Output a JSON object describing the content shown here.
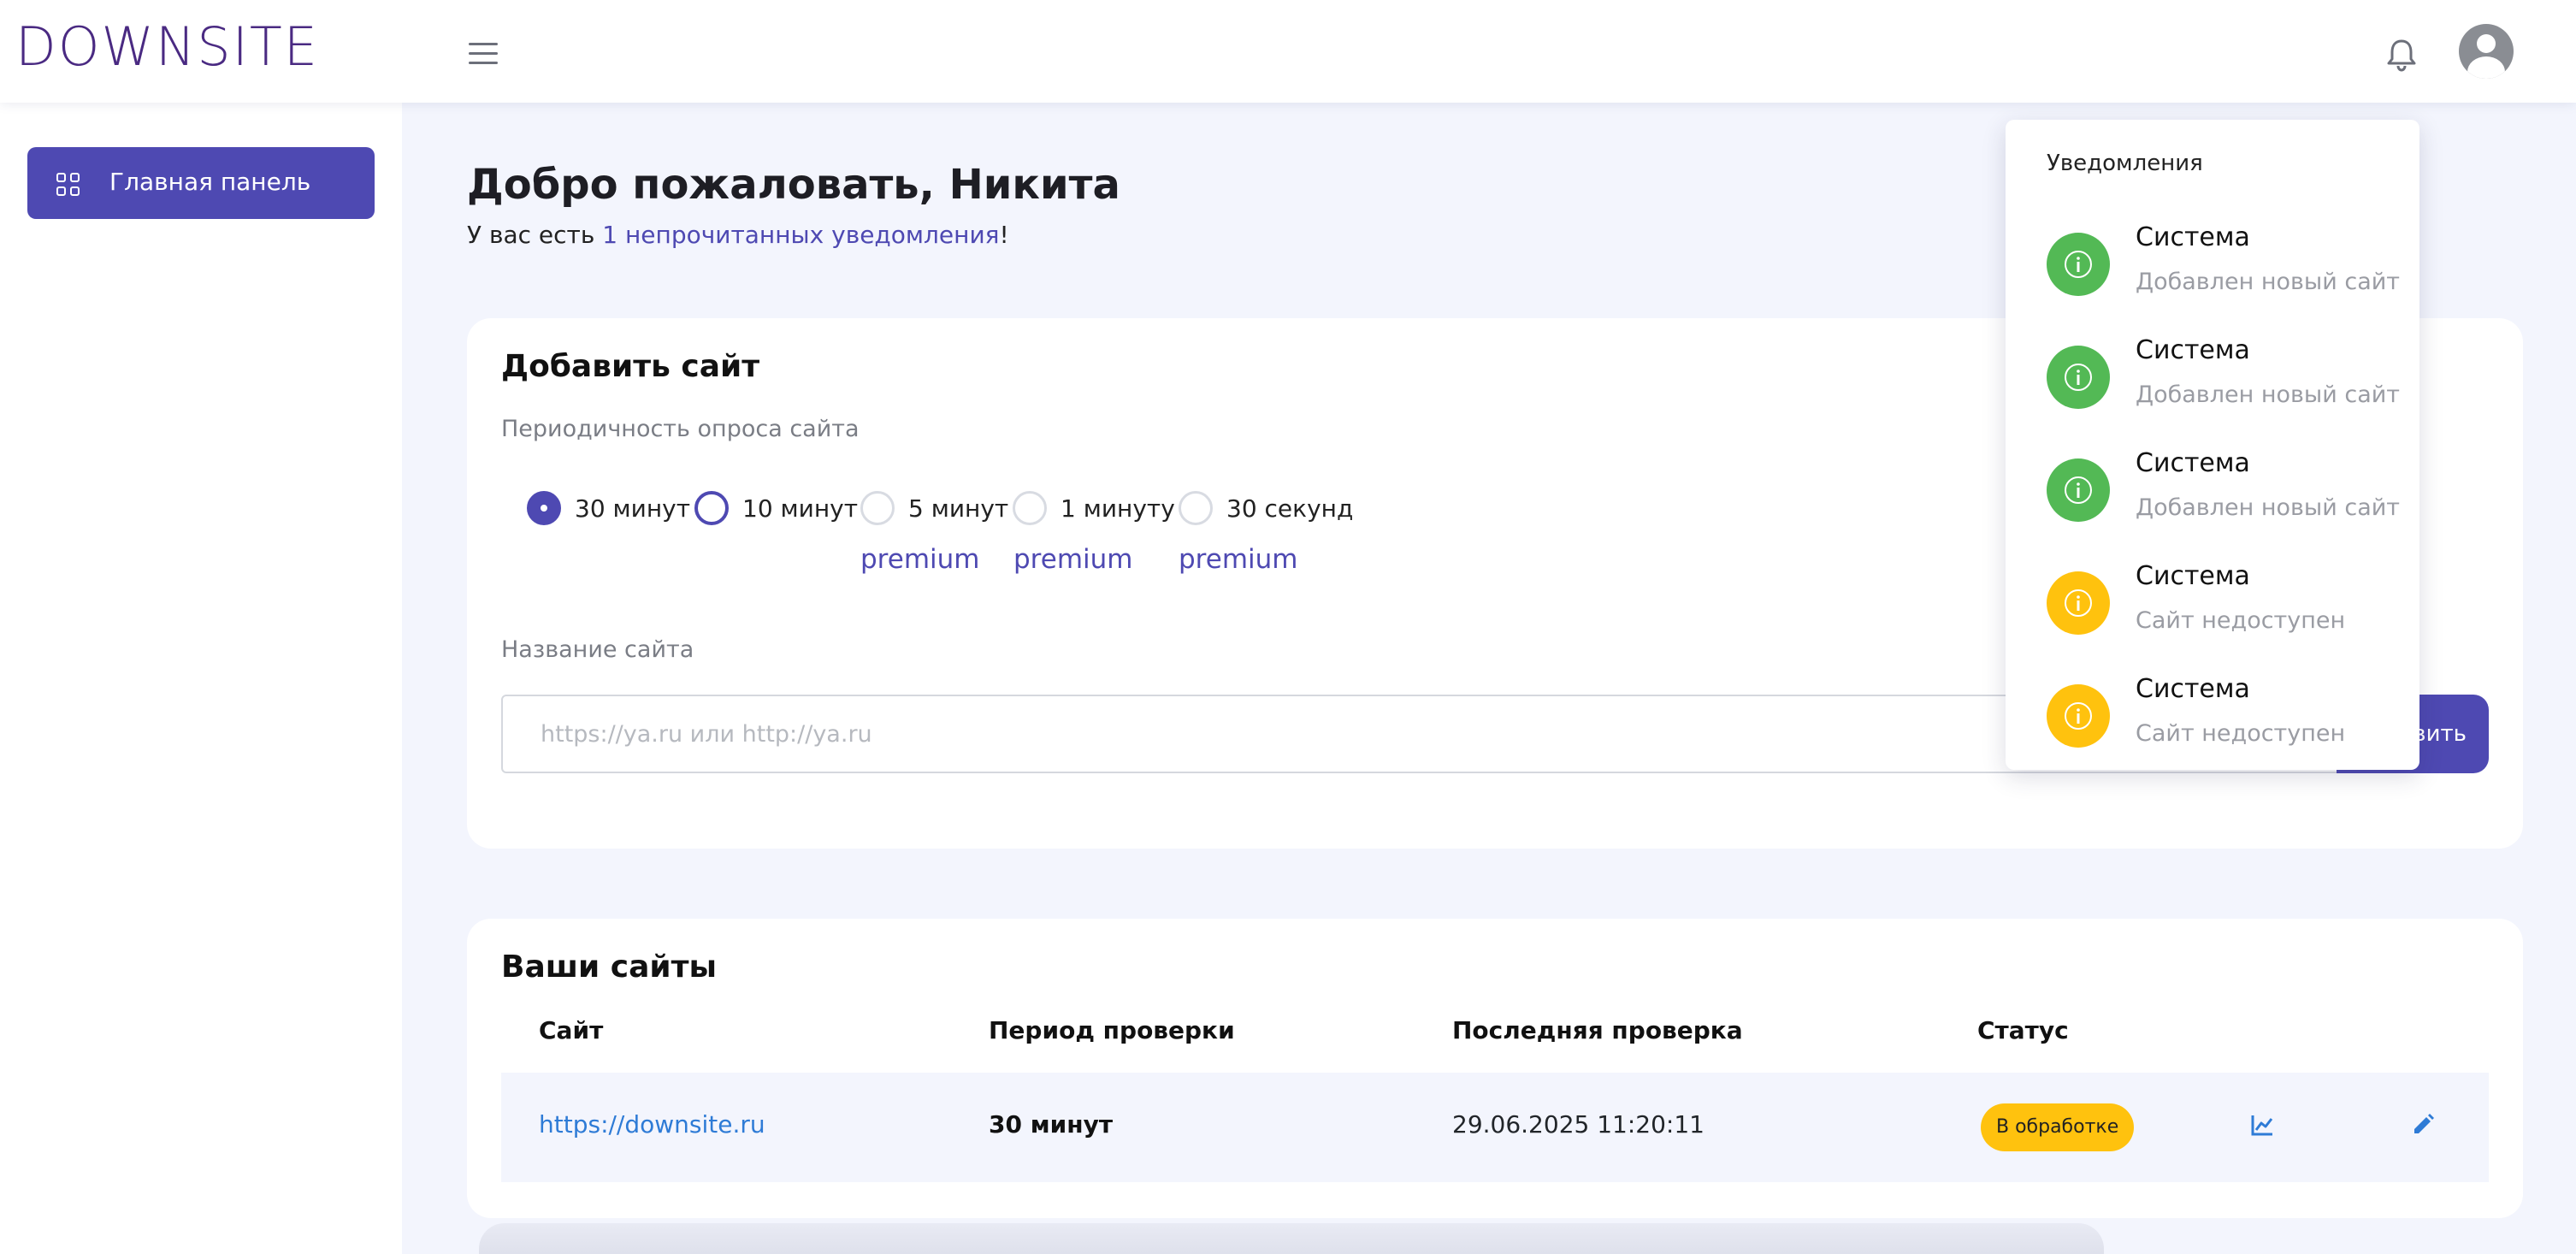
{
  "header": {
    "logo": "DOWNSITE"
  },
  "sidebar": {
    "items": [
      {
        "label": "Главная панель"
      }
    ]
  },
  "welcome": {
    "title": "Добро пожаловать, Никита",
    "sub_prefix": "У вас есть ",
    "sub_link": "1 непрочитанных уведомления",
    "sub_suffix": "!"
  },
  "add_site": {
    "title": "Добавить сайт",
    "interval_label": "Периодичность опроса сайта",
    "intervals": [
      {
        "label": "30 минут",
        "checked": true
      },
      {
        "label": "10 минут",
        "checked": false
      },
      {
        "label": "5 минут",
        "checked": false,
        "badge": "premium"
      },
      {
        "label": "1 минуту",
        "checked": false,
        "badge": "premium"
      },
      {
        "label": "30 секунд",
        "checked": false,
        "badge": "premium"
      }
    ],
    "name_label": "Название сайта",
    "url_placeholder": "https://ya.ru или http://ya.ru",
    "url_value": "",
    "submit_label": "вить"
  },
  "sites": {
    "title": "Ваши сайты",
    "columns": [
      "Сайт",
      "Период проверки",
      "Последняя проверка",
      "Статус"
    ],
    "rows": [
      {
        "site": "https://downsite.ru",
        "period": "30 минут",
        "last_check": "29.06.2025 11:20:11",
        "status": "В обработке"
      }
    ]
  },
  "notifications": {
    "title": "Уведомления",
    "items": [
      {
        "title": "Система",
        "text": "Добавлен новый сайт",
        "color": "#53b955"
      },
      {
        "title": "Система",
        "text": "Добавлен новый сайт",
        "color": "#53b955"
      },
      {
        "title": "Система",
        "text": "Добавлен новый сайт",
        "color": "#53b955"
      },
      {
        "title": "Система",
        "text": "Сайт недоступен",
        "color": "#ffc20e"
      },
      {
        "title": "Система",
        "text": "Сайт недоступен",
        "color": "#ffc20e"
      }
    ]
  },
  "colors": {
    "accent": "#4e49b2",
    "success": "#53b955",
    "warning": "#ffc20e",
    "link": "#2e7bd6"
  }
}
